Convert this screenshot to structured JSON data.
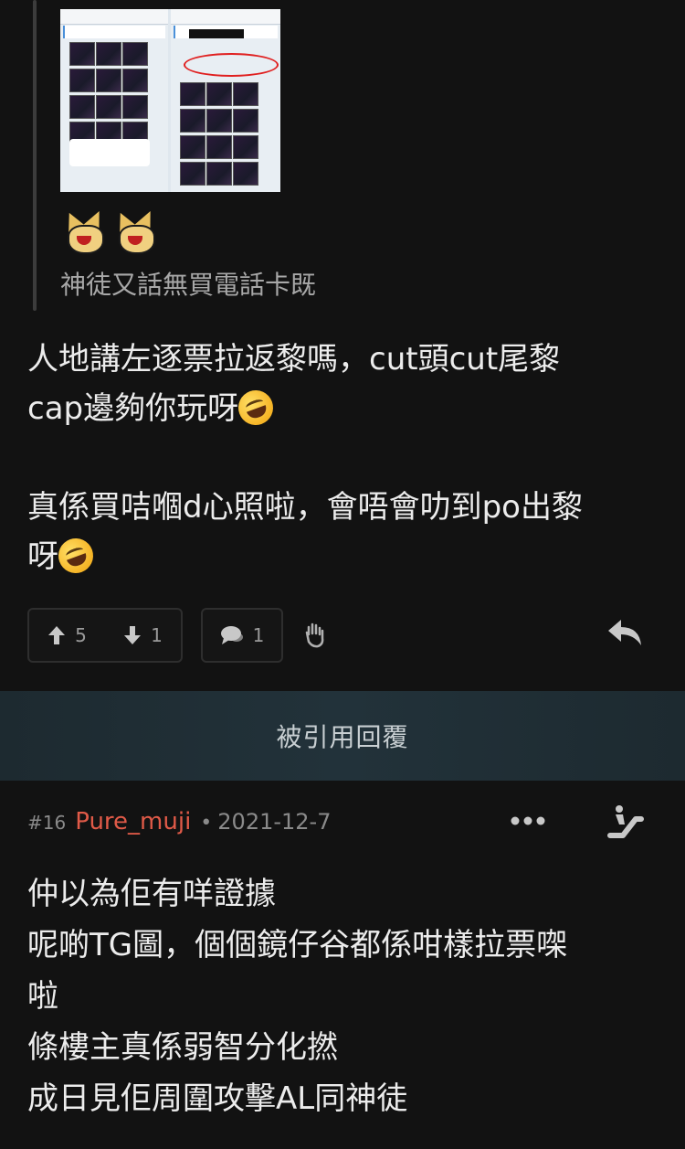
{
  "post1": {
    "quote": {
      "text": "神徒又話無買電話卡既"
    },
    "body_lines": [
      "人地講左逐票拉返黎嗎，cut頭cut尾黎",
      "cap邊夠你玩呀",
      "真係買咭嗰d心照啦，會唔會叻到po出黎",
      "呀"
    ],
    "votes": {
      "up": "5",
      "down": "1"
    },
    "comments": "1"
  },
  "quoted_replies_label": "被引用回覆",
  "post2": {
    "floor": "#16",
    "username": "Pure_muji",
    "separator": "•",
    "date": "2021-12-7",
    "body_lines": [
      "仲以為佢有咩證據",
      "呢啲TG圖，個個鏡仔谷都係咁樣拉票㗎",
      "啦",
      "條樓主真係弱智分化撚",
      "成日見佢周圍攻擊AL同神徒"
    ]
  },
  "colors": {
    "background": "#121212",
    "username": "#e05a48",
    "muted": "#8a8a8a",
    "quoted_bar": "#22323a"
  },
  "icons": [
    "rofl-emoji",
    "arrow-up-icon",
    "arrow-down-icon",
    "comment-icon",
    "hand-stop-icon",
    "reply-icon",
    "more-icon",
    "escalator-icon"
  ]
}
